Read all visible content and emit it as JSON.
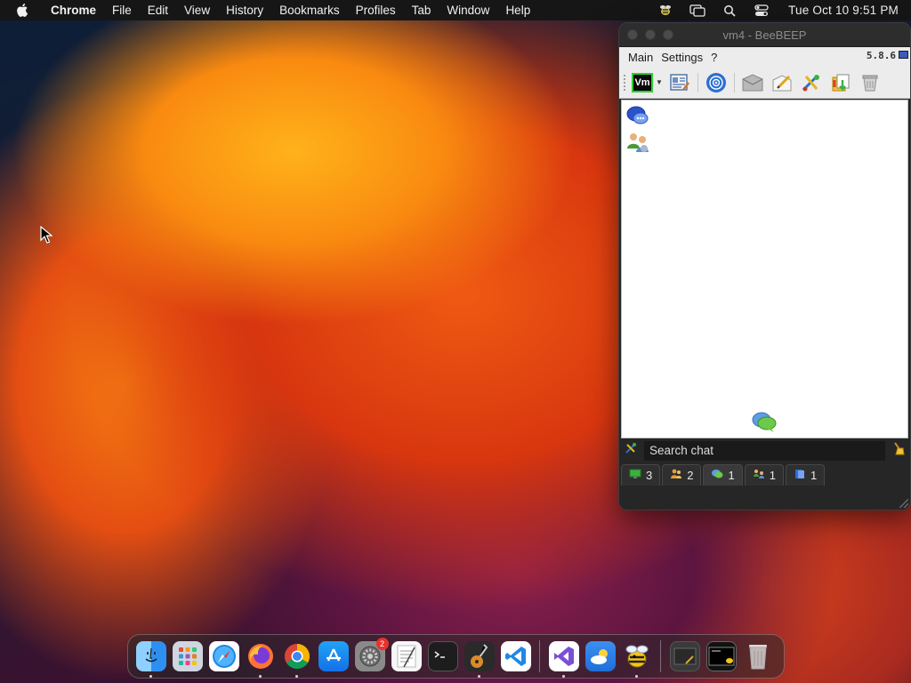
{
  "menubar": {
    "app_name": "Chrome",
    "items": [
      "File",
      "Edit",
      "View",
      "History",
      "Bookmarks",
      "Profiles",
      "Tab",
      "Window",
      "Help"
    ],
    "status_icons": [
      "beebeep-tray-icon",
      "screen-mirroring-icon",
      "spotlight-search-icon",
      "control-center-icon"
    ],
    "clock": "Tue Oct 10  9:51 PM"
  },
  "beebeep": {
    "title": "vm4 - BeeBEEP",
    "menu": [
      "Main",
      "Settings",
      "?"
    ],
    "version": "5.8.6",
    "user_badge": "Vm",
    "toolbar_icons": [
      "edit-profile-icon",
      "broadcast-icon",
      "file-folder-icon",
      "write-note-icon",
      "plugins-icon",
      "chat-history-icon",
      "trash-icon"
    ],
    "content_icons": [
      "chat-bubbles-icon",
      "users-group-icon"
    ],
    "search_placeholder": "Search chat",
    "tabs": [
      {
        "icon": "monitor-icon",
        "count": "3"
      },
      {
        "icon": "users-icon",
        "count": "2"
      },
      {
        "icon": "chats-icon",
        "count": "1"
      },
      {
        "icon": "groups-icon",
        "count": "1"
      },
      {
        "icon": "files-icon",
        "count": "1"
      }
    ]
  },
  "dock": {
    "apps": [
      "Finder",
      "Launchpad",
      "Safari",
      "Firefox",
      "Google Chrome",
      "App Store",
      "System Settings",
      "TextEdit",
      "Terminal",
      "Instruments",
      "Visual Studio Code",
      "Visual Studio",
      "Weather",
      "BeeBEEP"
    ],
    "system_settings_badge": "2",
    "minimized": [
      "minimized-window-1",
      "minimized-window-2"
    ],
    "trash": "Trash"
  },
  "colors": {
    "menubar_bg": "#161616",
    "window_bg": "#262626",
    "accent_green": "#2ed12e"
  }
}
